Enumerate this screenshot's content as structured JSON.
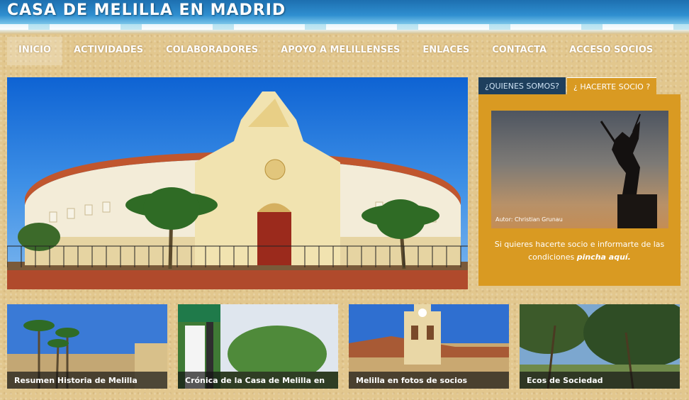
{
  "site": {
    "title": "CASA DE MELILLA EN MADRID"
  },
  "nav": {
    "items": [
      {
        "label": "INICIO"
      },
      {
        "label": "ACTIVIDADES"
      },
      {
        "label": "COLABORADORES"
      },
      {
        "label": "APOYO A MELILLENSES"
      },
      {
        "label": "ENLACES"
      },
      {
        "label": "CONTACTA"
      },
      {
        "label": "ACCESO SOCIOS"
      }
    ]
  },
  "sidebar": {
    "tabs": [
      {
        "label": "¿QUIENES SOMOS?"
      },
      {
        "label": "¿ HACERTE SOCIO ?"
      }
    ],
    "image_credit": "Autor: Christian Grunau",
    "text_before": "Si quieres hacerte socio e informarte de las condiciones ",
    "link_label": "pincha aquí."
  },
  "thumbs": [
    {
      "caption": "Resumen Historia de Melilla"
    },
    {
      "caption": "Crónica de la Casa de Melilla en"
    },
    {
      "caption": "Melilla en fotos de socios"
    },
    {
      "caption": "Ecos de Sociedad"
    }
  ],
  "colors": {
    "accent": "#d99a22",
    "tab_dark": "#1e3f5d"
  }
}
